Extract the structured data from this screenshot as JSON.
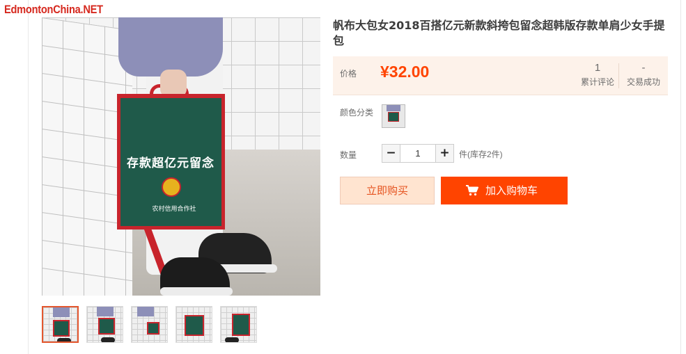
{
  "site": {
    "logo_text": "EdmontonChina.NET"
  },
  "product": {
    "title": "帆布大包女2018百搭亿元新款斜挎包留念超韩版存款单肩少女手提包",
    "image_text": {
      "arc": "存款超亿元留念",
      "sub": "农村信用合作社"
    },
    "thumbnail_count": 5,
    "active_thumbnail": 0
  },
  "price": {
    "label": "价格",
    "value": "¥32.00",
    "accent_color": "#ff4400"
  },
  "stats": [
    {
      "value": "1",
      "label": "累计评论"
    },
    {
      "value": "-",
      "label": "交易成功"
    }
  ],
  "sku": {
    "label": "颜色分类"
  },
  "quantity": {
    "label": "数量",
    "minus": "−",
    "value": "1",
    "plus": "+",
    "stock_text": "件(库存2件)"
  },
  "actions": {
    "buy_now": "立即购买",
    "add_to_cart": "加入购物车",
    "cart_icon": "shopping-cart-icon"
  }
}
